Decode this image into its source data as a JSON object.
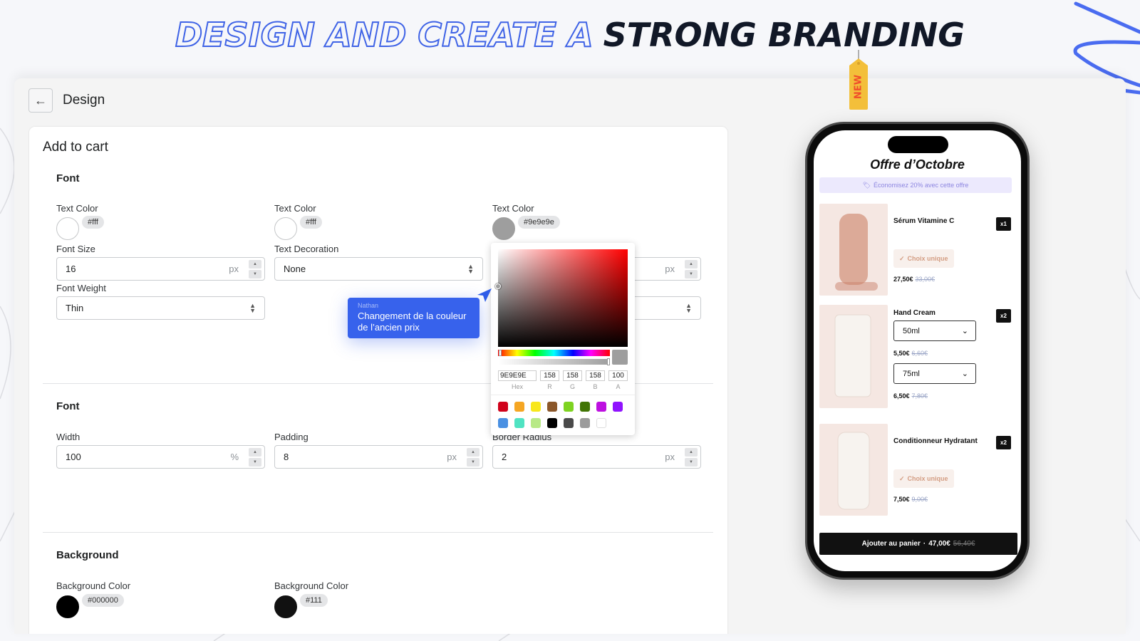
{
  "headline": {
    "outline_text": "DESIGN AND CREATE A",
    "solid_text": "STRONG BRANDING"
  },
  "tag": {
    "label": "NEW"
  },
  "app": {
    "back_label": "←",
    "title": "Design",
    "card_title": "Add to cart",
    "sections": {
      "font1": {
        "title": "Font",
        "text_colors": [
          {
            "label": "Text Color",
            "value": "#fff",
            "swatch": "#ffffff"
          },
          {
            "label": "Text Color",
            "value": "#fff",
            "swatch": "#ffffff"
          },
          {
            "label": "Text Color",
            "value": "#9e9e9e",
            "swatch": "#9e9e9e"
          }
        ],
        "font_size": {
          "label": "Font Size",
          "value": "16",
          "unit": "px"
        },
        "text_decoration": {
          "label": "Text Decoration",
          "value": "None"
        },
        "third_size": {
          "unit": "px"
        },
        "font_weight": {
          "label": "Font Weight",
          "value": "Thin"
        }
      },
      "font2": {
        "title": "Font",
        "width": {
          "label": "Width",
          "value": "100",
          "unit": "%"
        },
        "padding": {
          "label": "Padding",
          "value": "8",
          "unit": "px"
        },
        "border_radius": {
          "label": "Border Radius",
          "value": "2",
          "unit": "px"
        }
      },
      "background": {
        "title": "Background",
        "colors": [
          {
            "label": "Background Color",
            "value": "#000000",
            "swatch": "#000000"
          },
          {
            "label": "Background Color",
            "value": "#111",
            "swatch": "#111111"
          }
        ]
      }
    },
    "color_picker": {
      "hex": "9E9E9E",
      "r": "158",
      "g": "158",
      "b": "158",
      "a": "100",
      "labels": {
        "hex": "Hex",
        "r": "R",
        "g": "G",
        "b": "B",
        "a": "A"
      },
      "presets": [
        "#d0021b",
        "#f5a623",
        "#f8e71c",
        "#8b572a",
        "#7ed321",
        "#417505",
        "#bd10e0",
        "#9013fe",
        "#4a90e2",
        "#50e3c2",
        "#b8e986",
        "#000000",
        "#4a4a4a",
        "#9b9b9b",
        "#ffffff"
      ]
    },
    "comment": {
      "author": "Nathan",
      "message": "Changement de la couleur de l’ancien prix"
    }
  },
  "phone": {
    "title": "Offre d’Octobre",
    "banner": "Économisez 20% avec cette offre",
    "products": [
      {
        "name": "Sérum Vitamine C",
        "qty": "x1",
        "choice": "Choix unique",
        "price": "27,50€",
        "old_price": "33,00€"
      },
      {
        "name": "Hand Cream",
        "qty": "x2",
        "variants": [
          {
            "option": "50ml",
            "price": "5,50€",
            "old_price": "6,60€"
          },
          {
            "option": "75ml",
            "price": "6,50€",
            "old_price": "7,80€"
          }
        ]
      },
      {
        "name": "Conditionneur Hydratant",
        "qty": "x2",
        "choice": "Choix unique",
        "price": "7,50€",
        "old_price": "9,00€"
      }
    ],
    "cta": {
      "label": "Ajouter au panier",
      "sep": "·",
      "price": "47,00€",
      "old_price": "56,40€"
    }
  }
}
